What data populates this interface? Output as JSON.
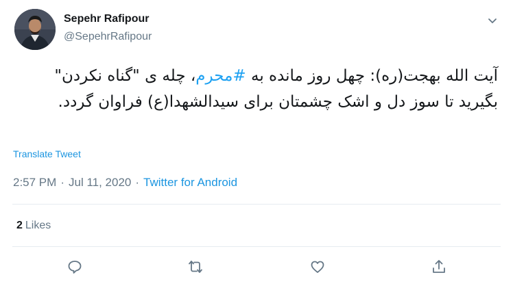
{
  "author": {
    "name": "Sepehr Rafipour",
    "handle": "@SepehrRafipour",
    "avatar_icon": "profile-photo"
  },
  "tweet": {
    "text_before_hashtag": "آیت الله بهجت(ره): چهل روز مانده به ",
    "hashtag": "#محرم",
    "text_after_hashtag": "، چله ی \"گناه نکردن\" بگیرید تا سوز دل و اشک چشمتان برای سیدالشهدا(ع) فراوان گردد.",
    "translate_label": "Translate Tweet"
  },
  "meta": {
    "time": "2:57 PM",
    "separator1": "·",
    "date": "Jul 11, 2020",
    "separator2": "·",
    "source": "Twitter for Android"
  },
  "stats": {
    "likes_count": "2",
    "likes_label": "Likes"
  },
  "actions": [
    {
      "icon": "reply-icon"
    },
    {
      "icon": "retweet-icon"
    },
    {
      "icon": "like-icon"
    },
    {
      "icon": "share-icon"
    }
  ],
  "colors": {
    "accent": "#1da1f2",
    "text": "#14171a",
    "secondary": "#657786",
    "divider": "#e6ecf0"
  }
}
